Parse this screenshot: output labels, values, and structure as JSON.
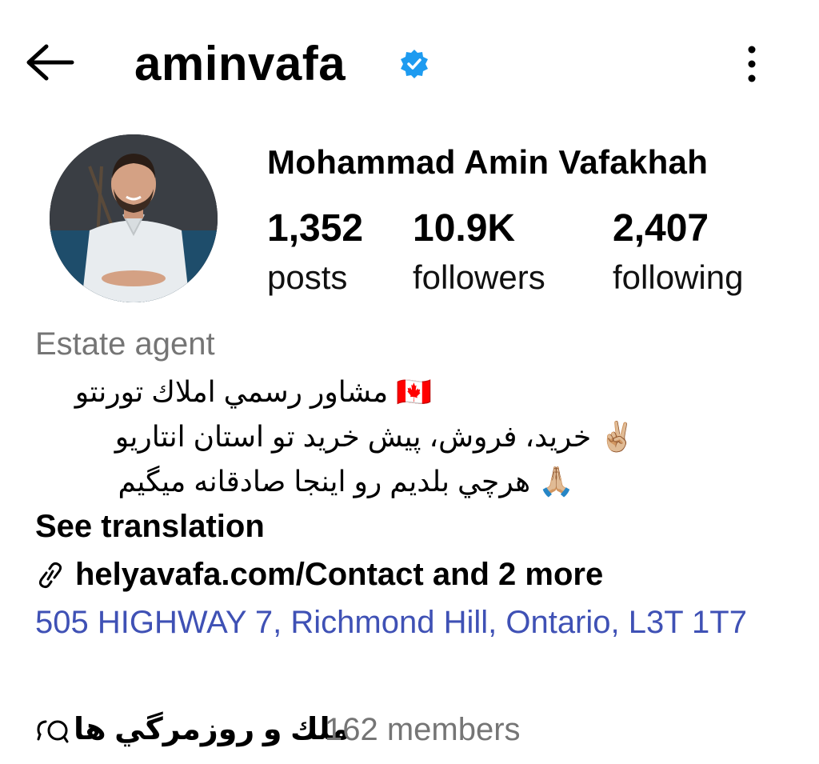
{
  "header": {
    "username": "aminvafa",
    "verified_color": "#1d9bf0"
  },
  "profile": {
    "full_name": "Mohammad Amin Vafakhah",
    "stats": [
      {
        "value": "1,352",
        "label": "posts"
      },
      {
        "value": "10.9K",
        "label": "followers"
      },
      {
        "value": "2,407",
        "label": "following"
      }
    ],
    "category": "Estate agent",
    "bio": [
      "🇨🇦 مشاور رسمي املاك تورنتو",
      "✌🏼 خريد، فروش، پيش خريد تو استان انتاريو",
      "🙏🏼 هرچي بلديم رو اينجا صادقانه ميگيم"
    ],
    "see_translation": "See translation",
    "link": "helyavafa.com/Contact and 2 more",
    "address": "505 HIGHWAY 7, Richmond Hill, Ontario, L3T 1T7",
    "channel": {
      "name": "ملك و روزمرگي ها",
      "members": "162 members"
    }
  },
  "icons": {
    "back": "arrow-left-icon",
    "more": "more-vertical-icon",
    "link": "link-icon",
    "channel": "chat-bubbles-icon",
    "verified": "verified-badge-icon"
  },
  "colors": {
    "link_blue": "#3f51b5",
    "secondary_text": "#757575"
  }
}
